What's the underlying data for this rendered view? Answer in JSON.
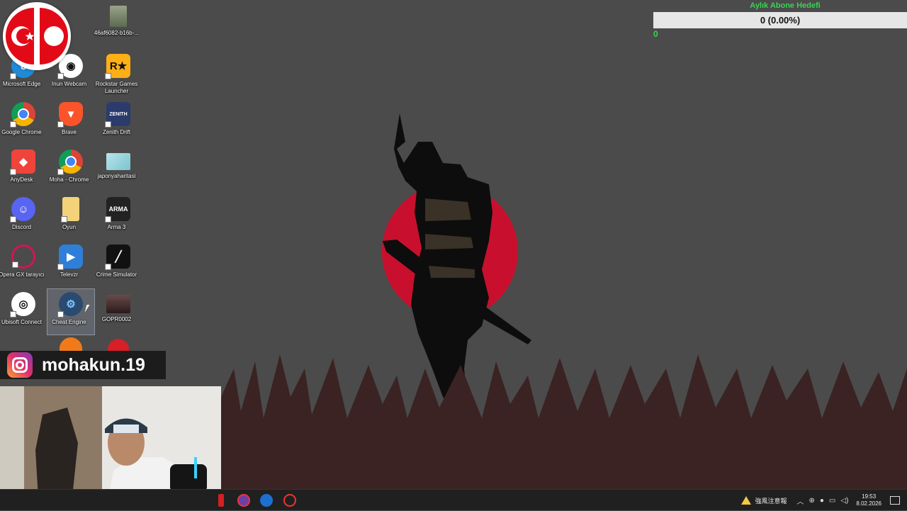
{
  "desktop": {
    "icons": [
      {
        "label": "Microsoft Edge",
        "glyph": "edge-icon",
        "color": "#1f8ad6"
      },
      {
        "label": "Google Chrome",
        "glyph": "chrome-icon",
        "color": "#db4437"
      },
      {
        "label": "AnyDesk",
        "glyph": "anydesk-icon",
        "color": "#ef443b"
      },
      {
        "label": "Discord",
        "glyph": "discord-icon",
        "color": "#5865f2"
      },
      {
        "label": "Opera GX tarayıcı",
        "glyph": "opera-gx-icon",
        "color": "#d2145a"
      },
      {
        "label": "Ubisoft Connect",
        "glyph": "ubisoft-icon",
        "color": "#ffffff"
      },
      {
        "label": "Inun Webcam",
        "glyph": "webcam-icon",
        "color": "#1a1a1a"
      },
      {
        "label": "Brave",
        "glyph": "brave-icon",
        "color": "#fb542b"
      },
      {
        "label": "Moha - Chrome",
        "glyph": "chrome-profile-icon",
        "color": "#db4437"
      },
      {
        "label": "Oyun",
        "glyph": "folder-icon",
        "color": "#f3d27a"
      },
      {
        "label": "Televzr",
        "glyph": "televzr-icon",
        "color": "#2f7fd8"
      },
      {
        "label": "Cheat Engine",
        "glyph": "cheat-engine-icon",
        "color": "#3a8ad0"
      },
      {
        "label": "46af6082-b16b-...",
        "glyph": "image-file-icon",
        "color": "#7a8a6a"
      },
      {
        "label": "Rockstar Games Launcher",
        "glyph": "rockstar-icon",
        "color": "#fcaf17"
      },
      {
        "label": "Zenith Drift",
        "glyph": "zenith-drift-icon",
        "color": "#2b3b6b"
      },
      {
        "label": "japonyaharitasi",
        "glyph": "map-image-icon",
        "color": "#8fd0d8"
      },
      {
        "label": "Arma 3",
        "glyph": "arma3-icon",
        "color": "#222222"
      },
      {
        "label": "Crime Simulator",
        "glyph": "crime-simulator-icon",
        "color": "#111111"
      },
      {
        "label": "GOPR0002",
        "glyph": "video-file-icon",
        "color": "#5a3a3a"
      }
    ]
  },
  "subscriber_goal": {
    "title": "Aylık Abone Hedefi",
    "progress_text": "0 (0.00%)",
    "progress": 0,
    "count": "0"
  },
  "instagram": {
    "handle": "mohakun.19"
  },
  "tray": {
    "weather_text": "強風注意報",
    "time": "19:53",
    "date": "8.02.2026"
  },
  "colors": {
    "wallpaper_bg": "#4b4b4b",
    "sun": "#c8102e",
    "grass": "#3a2020",
    "goal_green": "#39d353"
  }
}
